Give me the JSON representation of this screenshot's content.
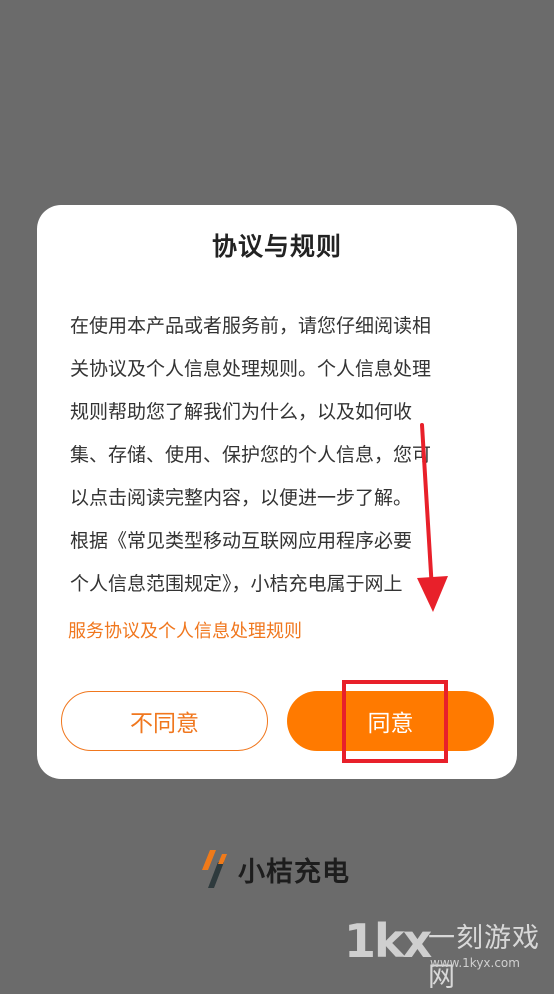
{
  "dialog": {
    "title": "协议与规则",
    "body_lines": [
      "在使用本产品或者服务前，请您仔细阅读相",
      "关协议及个人信息处理规则。个人信息处理",
      "规则帮助您了解我们为什么，以及如何收",
      "集、存储、使用、保护您的个人信息，您可",
      "以点击阅读完整内容，以便进一步了解。",
      "根据《常见类型移动互联网应用程序必要",
      "个人信息范围规定》，小桔充电属于网上"
    ],
    "link_text": "服务协议及个人信息处理规则",
    "disagree_label": "不同意",
    "agree_label": "同意"
  },
  "brand": {
    "name": "小桔充电"
  },
  "watermark": {
    "logo_text": "1kx",
    "name": "一刻游戏网",
    "url": "www.1kyx.com"
  },
  "colors": {
    "accent": "#ff7a00",
    "link": "#f0771e",
    "annotation": "#e8202a",
    "overlay": "#6b6b6b"
  }
}
